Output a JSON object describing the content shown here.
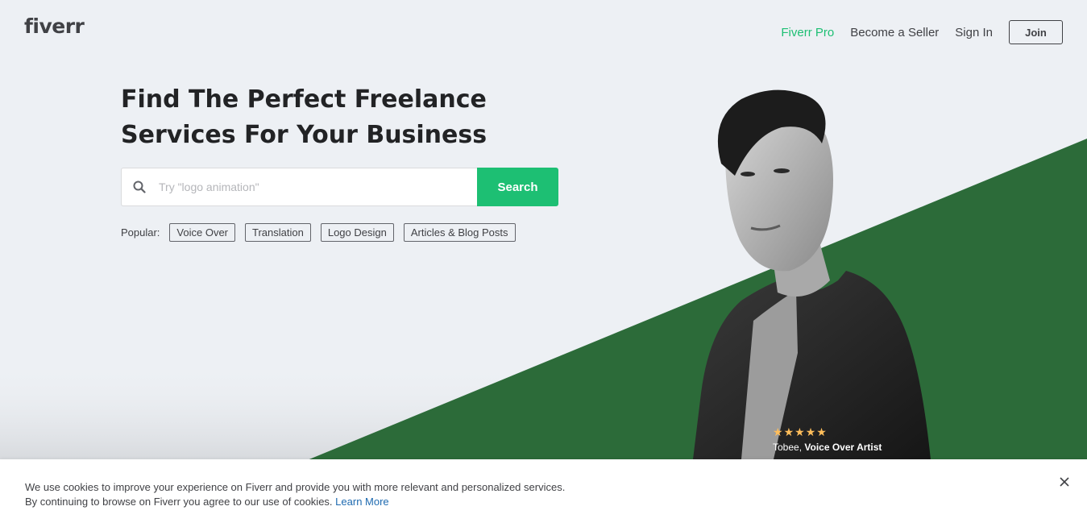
{
  "header": {
    "logo": "fiverr",
    "nav": {
      "pro": "Fiverr Pro",
      "become_seller": "Become a Seller",
      "sign_in": "Sign In",
      "join": "Join"
    }
  },
  "hero": {
    "title_line1": "Find The Perfect Freelance",
    "title_line2": "Services For Your Business",
    "search": {
      "placeholder": "Try \"logo animation\"",
      "value": "",
      "button_label": "Search"
    },
    "popular": {
      "label": "Popular:",
      "tags": [
        "Voice Over",
        "Translation",
        "Logo Design",
        "Articles & Blog Posts"
      ]
    }
  },
  "seller": {
    "rating_stars": 5,
    "name": "Tobee",
    "separator": ", ",
    "role": "Voice Over Artist"
  },
  "cookie_banner": {
    "line1": "We use cookies to improve your experience on Fiverr and provide you with more relevant and personalized services.",
    "line2": "By continuing to browse on Fiverr you agree to our use of cookies.",
    "learn_more": "Learn More"
  },
  "colors": {
    "brand_green": "#1dbf73",
    "hero_dark_green": "#2c6b39",
    "background": "#edf0f4",
    "link_blue": "#1e6ab0",
    "star": "#ffbe5b"
  },
  "icons": {
    "search": "search-icon",
    "close": "close-icon",
    "star": "star-icon"
  }
}
